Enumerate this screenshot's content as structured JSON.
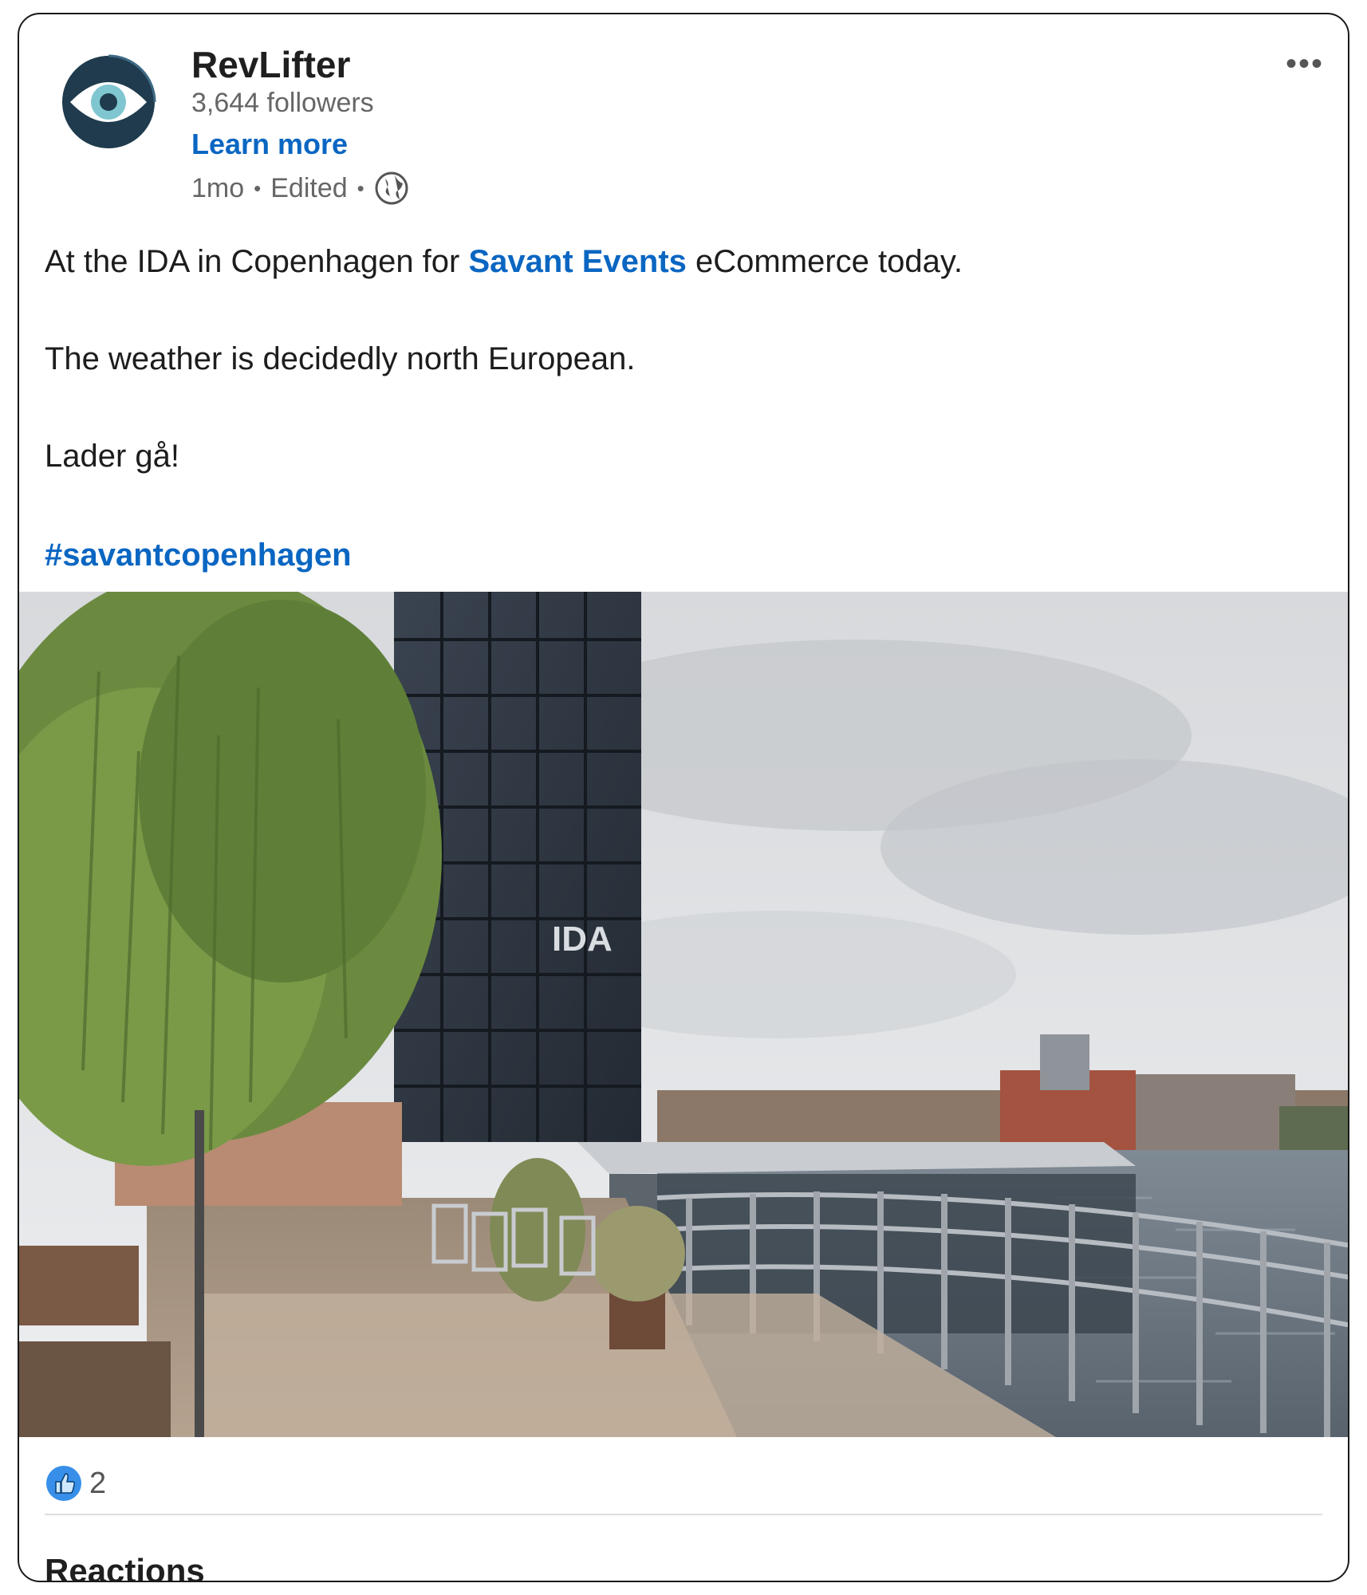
{
  "post": {
    "company_name": "RevLifter",
    "followers": "3,644 followers",
    "learn_more": "Learn more",
    "time": "1mo",
    "edited": "Edited",
    "more_label": "•••",
    "icons": [
      "company-logo",
      "globe-icon",
      "more-options-icon",
      "like-reaction-icon"
    ]
  },
  "body": {
    "line1_pre": "At the IDA in Copenhagen for ",
    "line1_link": "Savant Events",
    "line1_post": " eCommerce today.",
    "line2": "The weather is decidedly north European.",
    "line3": "Lader gå!",
    "hashtag": "#savantcopenhagen"
  },
  "photo": {
    "sign_text": "IDA"
  },
  "social": {
    "reaction_count": "2",
    "tab_label": "Reactions"
  },
  "colors": {
    "brand_blue": "#0a66c2",
    "logo_dark": "#1f3b4d",
    "logo_teal": "#7fc6d0"
  }
}
